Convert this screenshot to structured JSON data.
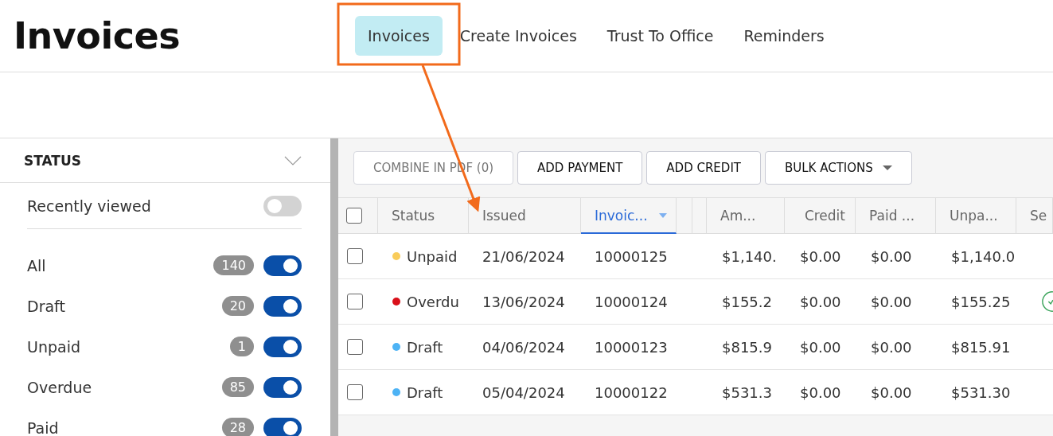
{
  "page": {
    "title": "Invoices"
  },
  "tabs": [
    {
      "label": "Invoices",
      "selected": true
    },
    {
      "label": "Create Invoices",
      "selected": false
    },
    {
      "label": "Trust To Office",
      "selected": false
    },
    {
      "label": "Reminders",
      "selected": false
    }
  ],
  "filter": {
    "title": "STATUS"
  },
  "recently_viewed": {
    "label": "Recently viewed",
    "on": false
  },
  "status_filters": [
    {
      "label": "All",
      "count": "140",
      "on": true
    },
    {
      "label": "Draft",
      "count": "20",
      "on": true
    },
    {
      "label": "Unpaid",
      "count": "1",
      "on": true
    },
    {
      "label": "Overdue",
      "count": "85",
      "on": true
    },
    {
      "label": "Paid",
      "count": "28",
      "on": true
    }
  ],
  "toolbar": {
    "buttons": [
      {
        "label": "COMBINE IN PDF (0)",
        "kind": "plain",
        "disabled": true
      },
      {
        "label": "ADD PAYMENT",
        "kind": "plain",
        "disabled": false
      },
      {
        "label": "ADD CREDIT",
        "kind": "plain",
        "disabled": false
      },
      {
        "label": "BULK ACTIONS",
        "kind": "dropdown",
        "disabled": false
      }
    ]
  },
  "table": {
    "all_checked": false,
    "columns": [
      {
        "label": "Status",
        "sorted": false
      },
      {
        "label": "Issued",
        "sorted": false
      },
      {
        "label": "Invoic...",
        "sorted": true
      },
      {
        "label": "Am...",
        "sorted": false
      },
      {
        "label": "Credit",
        "sorted": false
      },
      {
        "label": "Paid ...",
        "sorted": false
      },
      {
        "label": "Unpa...",
        "sorted": false
      },
      {
        "label": "Se",
        "sorted": false
      }
    ],
    "rows": [
      {
        "checked": false,
        "status": "Unpaid",
        "color": "#f9cc5a",
        "issued": "21/06/2024",
        "invoice": "10000125",
        "amount": "$1,140.",
        "credit": "$0.00",
        "paid": "$0.00",
        "unpaid": "$1,140.0",
        "sent": false
      },
      {
        "checked": false,
        "status": "Overdu",
        "color": "#d9101a",
        "issued": "13/06/2024",
        "invoice": "10000124",
        "amount": "$155.2",
        "credit": "$0.00",
        "paid": "$0.00",
        "unpaid": "$155.25",
        "sent": true
      },
      {
        "checked": false,
        "status": "Draft",
        "color": "#4db3f5",
        "issued": "04/06/2024",
        "invoice": "10000123",
        "amount": "$815.9",
        "credit": "$0.00",
        "paid": "$0.00",
        "unpaid": "$815.91",
        "sent": false
      },
      {
        "checked": false,
        "status": "Draft",
        "color": "#4db3f5",
        "issued": "05/04/2024",
        "invoice": "10000122",
        "amount": "$531.3",
        "credit": "$0.00",
        "paid": "$0.00",
        "unpaid": "$531.30",
        "sent": false
      }
    ]
  }
}
